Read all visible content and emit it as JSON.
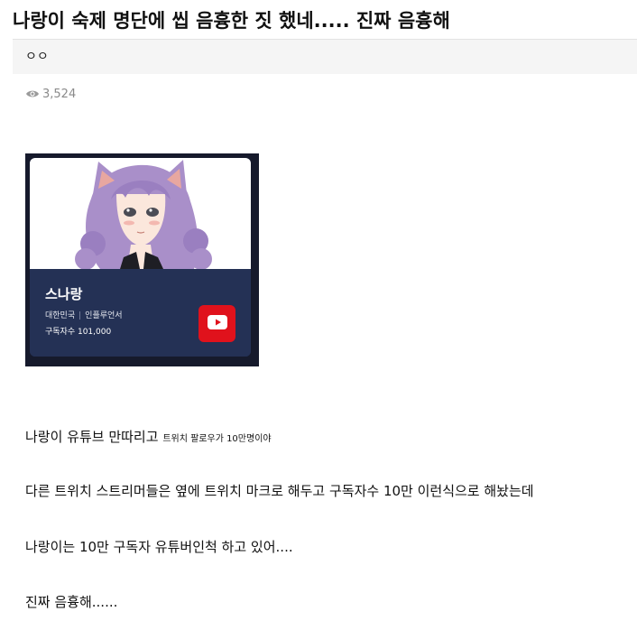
{
  "post": {
    "title": "나랑이 숙제 명단에 씹 음흉한 짓 했네..... 진짜 음흉해",
    "author": "ㅇㅇ",
    "views": "3,524"
  },
  "card": {
    "name": "스나랑",
    "country": "대한민국",
    "separator": "|",
    "category": "인플루언서",
    "subscribers": "구독자수 101,000"
  },
  "content": {
    "line1_main": "나랑이 유튜브 만따리고 ",
    "line1_small": "트위치 팔로우가 10만명이야",
    "line2": "다른 트위치 스트리머들은 옆에 트위치 마크로 해두고 구독자수 10만 이런식으로 해놨는데",
    "line3": "나랑이는 10만 구독자 유튜버인척 하고 있어....",
    "line4": "진짜 음흉해......"
  },
  "colors": {
    "card_bg": "#243155",
    "youtube_red": "#e0121c",
    "hair": "#a98fc9"
  },
  "icons": [
    "eye-icon",
    "youtube-icon"
  ]
}
